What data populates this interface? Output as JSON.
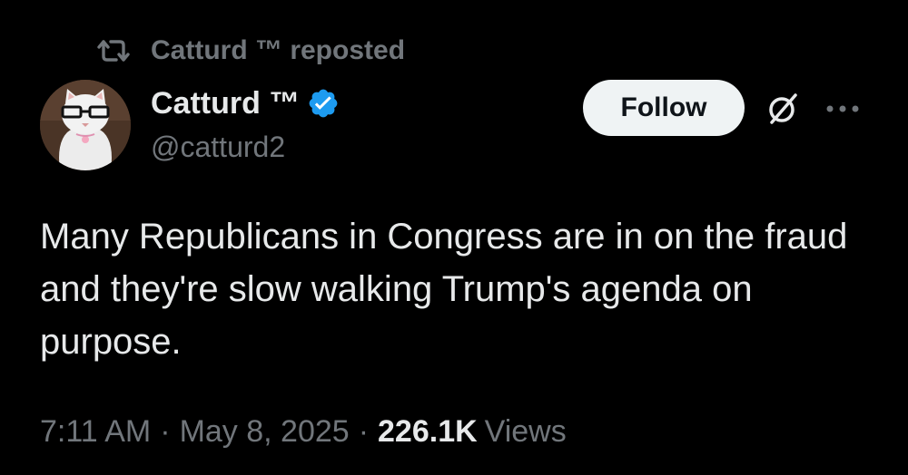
{
  "repost": {
    "text": "Catturd ™ reposted",
    "icon": "repost-icon"
  },
  "author": {
    "display_name": "Catturd ™",
    "handle": "@catturd2",
    "verified": true,
    "verified_color": "#1d9bf0",
    "avatar_icon": "cat-with-glasses-avatar"
  },
  "actions": {
    "follow_label": "Follow",
    "grok_icon": "grok-icon",
    "more_icon": "more-options-icon"
  },
  "tweet": {
    "text": "Many Republicans in Congress are in on the fraud and they're slow walking Trump's agenda on purpose."
  },
  "meta": {
    "time": "7:11 AM",
    "separator": "·",
    "date": "May 8, 2025",
    "views_count": "226.1K",
    "views_label": "Views"
  },
  "colors": {
    "background": "#000000",
    "primary_text": "#e7e9ea",
    "secondary_text": "#71767b",
    "follow_button_bg": "#eff3f4",
    "follow_button_text": "#0f1419"
  }
}
